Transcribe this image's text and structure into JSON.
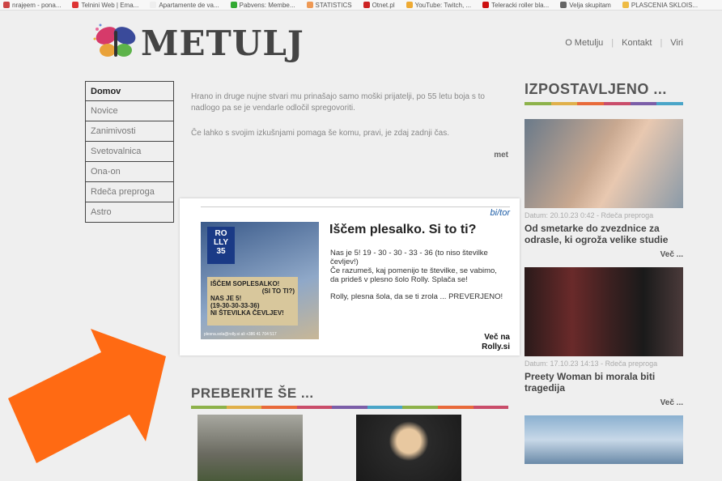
{
  "bookmarks": [
    "nraje̦em - pona...",
    "Telnini Web | Ema...",
    "Apartamente de va...",
    "Pabvens: Membe...",
    "STATISTICS",
    "Otnet.pl",
    "YouTube: Twitch, ...",
    "Teleracki roller bla...",
    "Velja skupitam",
    "PLASCENIA SKLOIS..."
  ],
  "header": {
    "logo": "METULJ",
    "nav": [
      "O Metulju",
      "Kontakt",
      "Viri"
    ]
  },
  "sidenav": [
    "Domov",
    "Novice",
    "Zanimivosti",
    "Svetovalnica",
    "Ona-on",
    "Rdeča preproga",
    "Astro"
  ],
  "intro": {
    "p1": "Hrano in druge nujne stvari mu prinašajo samo moški prijatelji, po 55 letu boja s to nadlogo pa se je vendarle odločil spregovoriti.",
    "p2": "Če lahko s svojim izkušnjami pomaga še komu, pravi, je zdaj zadnji čas.",
    "author": "met"
  },
  "featured": {
    "heading": "IZPOSTAVLJENO ...",
    "items": [
      {
        "meta": "Datum: 20.10.23 0:42 - Rdeča preproga",
        "title": "Od smetarke do zvezdnice za odrasle, ki ogroža velike studie",
        "more": "Več ..."
      },
      {
        "meta": "Datum: 17.10.23 14:13 - Rdeča preproga",
        "title": "Preety Woman bi morala biti tragedija",
        "more": "Več ..."
      }
    ]
  },
  "preberite": {
    "heading": "PREBERITE ŠE ..."
  },
  "ad": {
    "brand": "bi/tor",
    "title": "Iščem plesalko. Si to ti?",
    "body1": "Nas je 5! 19 - 30 - 30 - 33 - 36 (to niso številke čevljev!)",
    "body2": "Če razumeš, kaj pomenijo te številke, se vabimo, da prideš v plesno šolo Rolly. Splača se!",
    "body3": "Rolly, plesna šola, da se ti zrola ... PREVERJENO!",
    "link1": "Več na",
    "link2": "Rolly.si",
    "img_logo1": "RO",
    "img_logo2": "LLY",
    "img_logo3": "35",
    "img_sign1": "IŠČEM SOPLESALKO!",
    "img_sign2": "(SI TO TI?)",
    "img_sign3": "NAS JE 5!",
    "img_sign4": "(19-30-30-33-36)",
    "img_sign5": "NI ŠTEVILKA ČEVLJEV!",
    "img_contact": "plesna.sola@rolly.si ali +386 41 704 517"
  },
  "colors": {
    "arrow": "#ff6a13",
    "rainbow": [
      "#8db24a",
      "#e0b04a",
      "#e86a3a",
      "#c94d6a",
      "#7b5ea8",
      "#4aa5c8"
    ]
  }
}
